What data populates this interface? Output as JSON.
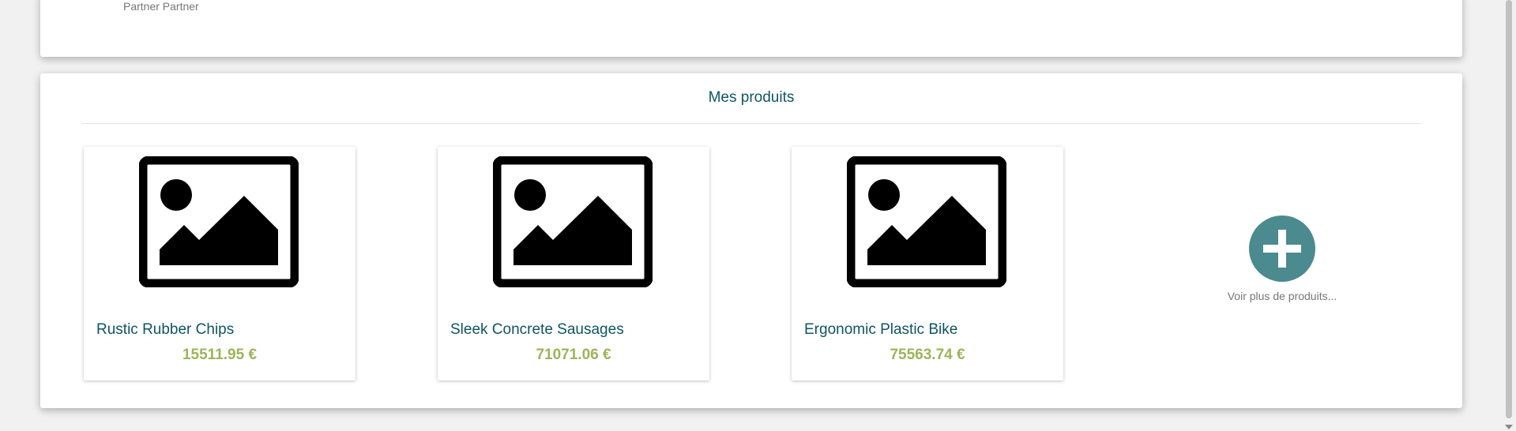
{
  "profile": {
    "name": "Partner Partner"
  },
  "products_section": {
    "title": "Mes produits",
    "items": [
      {
        "name": "Rustic Rubber Chips",
        "price": "15511.95 €"
      },
      {
        "name": "Sleek Concrete Sausages",
        "price": "71071.06 €"
      },
      {
        "name": "Ergonomic Plastic Bike",
        "price": "75563.74 €"
      }
    ],
    "more_label": "Voir plus de produits...",
    "more_icon": "plus-icon",
    "image_icon": "image-placeholder-icon"
  },
  "colors": {
    "title": "#0f5563",
    "price": "#9bb55a",
    "more_button": "#4b8a8f"
  }
}
